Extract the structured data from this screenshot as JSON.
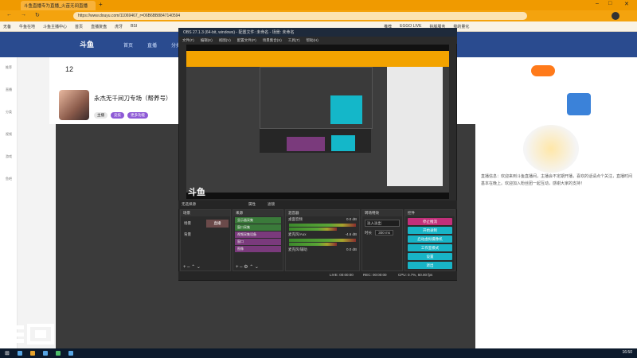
{
  "browser": {
    "tab_title": "斗鱼直播专为直播_火苗无间直播",
    "new_tab": "+",
    "url": "https://www.douyu.com/11069467_r=06B6BB8847140594",
    "bookmarks": [
      "无备",
      "牛鱼在地",
      "斗鱼主播中心",
      "首页",
      "直播复盘",
      "虎牙",
      "BSI",
      "推荐",
      "EGGO LIVE",
      "拍版服务",
      "我的量化"
    ],
    "window_controls": [
      "–",
      "□",
      "✕"
    ]
  },
  "site": {
    "nav_items": [
      "首页",
      "直播",
      "分类",
      "视频"
    ],
    "left_items": [
      "推荐",
      "直播",
      "分类",
      "视频",
      "游戏",
      "鱼吧"
    ],
    "level": "12",
    "streamer_title": "永杰无千间刀专场（帮养号）",
    "tag_labels": [
      "主播",
      "竞技",
      "更多功能"
    ],
    "notice": "直播信息：欢迎来到斗鱼直播间，主播会不定期开播，喜欢的话请点个关注，直播时间基本在晚上。欢迎加入粉丝团一起互动，感谢大家的支持！",
    "logo_text": "斗鱼"
  },
  "obs": {
    "title": "OBS 27.1.3 (64-bit, windows) - 配置文件: 未命名 - 场景: 未命名",
    "menu": [
      "文件(F)",
      "编辑(E)",
      "视图(V)",
      "配置文件(P)",
      "场景集合(S)",
      "工具(T)",
      "帮助(H)"
    ],
    "control_bar": [
      "无选择源",
      "属性",
      "滤镜"
    ],
    "docks": {
      "scenes": {
        "title": "场景",
        "items": [
          "场景",
          "背景",
          "直播"
        ]
      },
      "sources": {
        "title": "来源",
        "items": [
          "显示器采集",
          "窗口采集",
          "视频采集设备",
          "窗口",
          "图像"
        ]
      },
      "mixer": {
        "title": "混音器",
        "channels": [
          {
            "name": "桌面音频",
            "db": "0.0 dB"
          },
          {
            "name": "麦克风/Aux",
            "db": "-4.6 dB"
          },
          {
            "name": "麦克风/辅助",
            "db": "0.0 dB"
          }
        ]
      },
      "transitions": {
        "title": "转场特效",
        "type": "淡入淡出",
        "duration_label": "时长",
        "duration": "300 ms"
      },
      "controls": {
        "title": "控件",
        "buttons": [
          "停止推流",
          "开始录制",
          "启动虚拟摄像机",
          "工作室模式",
          "设置",
          "退出"
        ]
      }
    },
    "status": {
      "live": "LIVE: 00:00:00",
      "rec": "REC: 00:00:00",
      "cpu": "CPU: 0.7%, 60.00 fps"
    }
  },
  "taskbar": {
    "time": "16:50"
  },
  "colors": {
    "brand_orange": "#f09a00",
    "obs_accent": "#18b4c6",
    "nav_blue": "#2a4b8f"
  }
}
